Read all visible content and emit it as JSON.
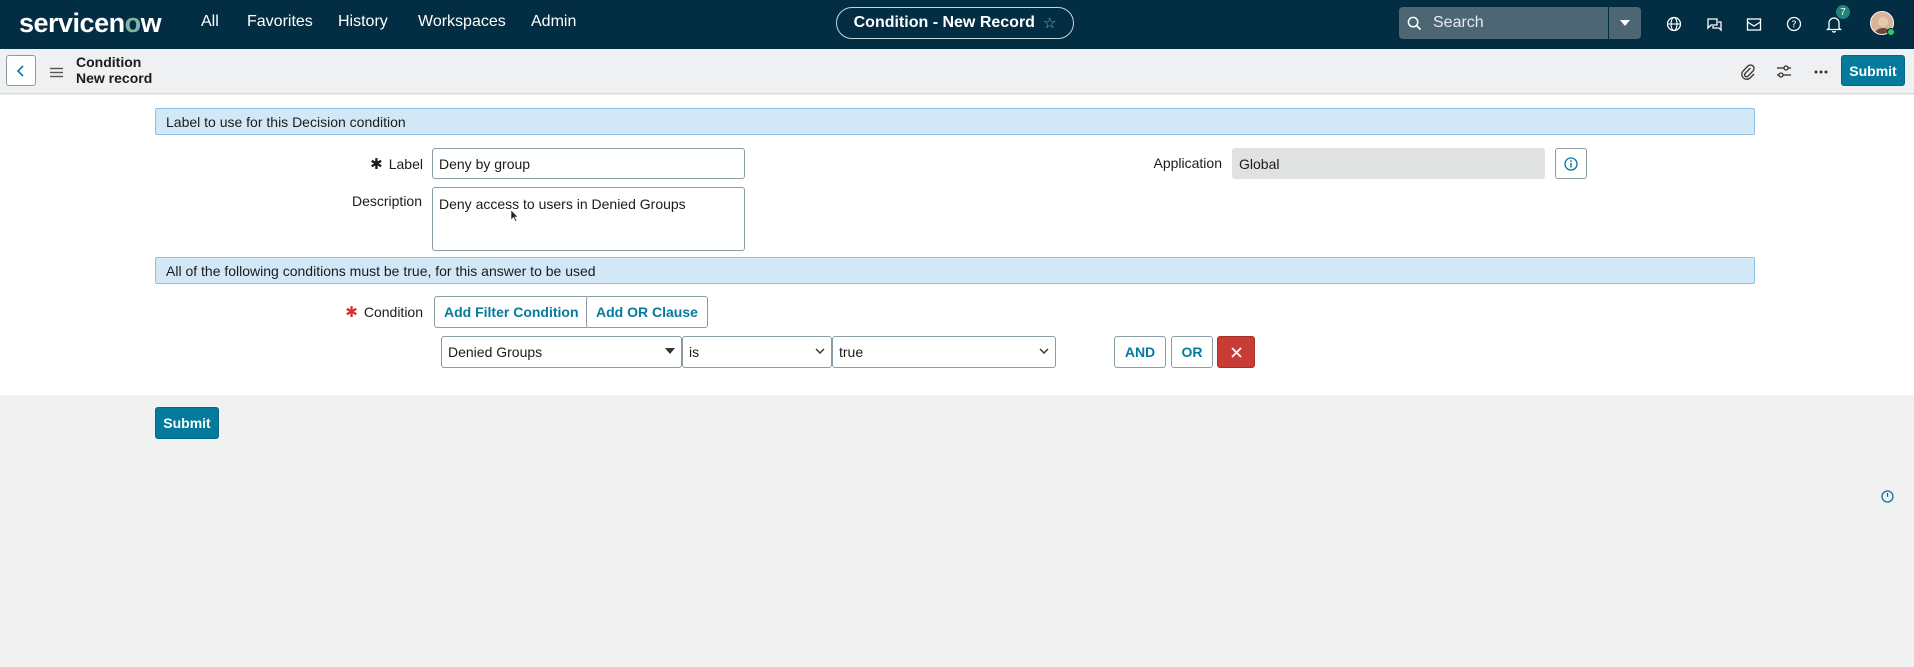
{
  "topnav": {
    "logo_prefix": "servicen",
    "logo_o": "o",
    "logo_suffix": "w",
    "menu": [
      "All",
      "Favorites",
      "History",
      "Workspaces",
      "Admin"
    ],
    "record_title": "Condition - New Record",
    "search_placeholder": "Search",
    "notification_count": "7",
    "icons": [
      "search-icon",
      "globe-icon",
      "chat-icon",
      "inbox-icon",
      "help-icon",
      "bell-icon"
    ]
  },
  "header": {
    "table": "Condition",
    "record": "New record",
    "submit_label": "Submit"
  },
  "form": {
    "section1": "Label to use for this Decision condition",
    "label_label": "Label",
    "label_value": "Deny by group",
    "description_label": "Description",
    "description_value": "Deny access to users in Denied Groups",
    "application_label": "Application",
    "application_value": "Global",
    "section2": "All of the following conditions must be true, for this answer to be used",
    "condition_label": "Condition",
    "add_filter_label": "Add Filter Condition",
    "add_or_label": "Add OR Clause",
    "filter_field": "Denied Groups",
    "filter_operator": "is",
    "filter_value": "true",
    "and_label": "AND",
    "or_label": "OR"
  },
  "footer": {
    "submit_label": "Submit"
  },
  "colors": {
    "nav_bg": "#032d42",
    "primary": "#047a9d",
    "section_bg": "#d3e8f7",
    "delete": "#c83c36",
    "required": "#d1372d"
  }
}
